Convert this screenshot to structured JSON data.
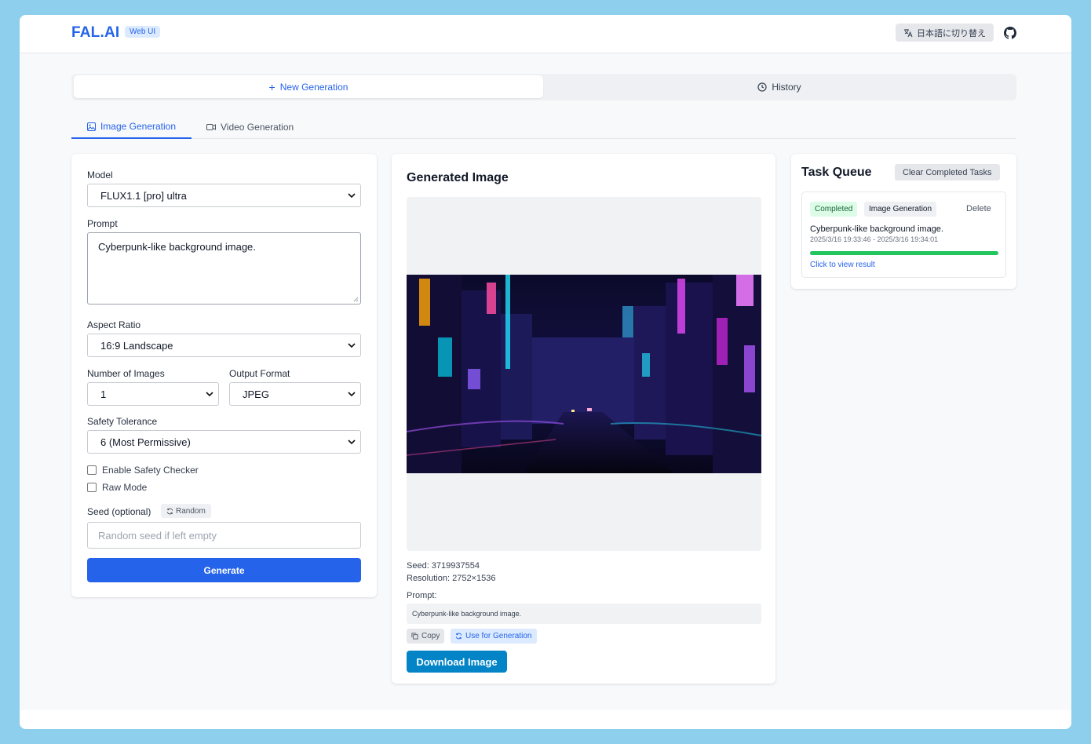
{
  "header": {
    "logo": "FAL.AI",
    "badge": "Web UI",
    "language_button": "日本語に切り替え"
  },
  "main_tabs": [
    {
      "label": "New Generation",
      "icon": "plus-icon",
      "active": true
    },
    {
      "label": "History",
      "icon": "clock-icon",
      "active": false
    }
  ],
  "sub_tabs": [
    {
      "label": "Image Generation",
      "icon": "image-icon",
      "active": true
    },
    {
      "label": "Video Generation",
      "icon": "video-icon",
      "active": false
    }
  ],
  "form": {
    "model_label": "Model",
    "model_value": "FLUX1.1 [pro] ultra",
    "prompt_label": "Prompt",
    "prompt_value": "Cyberpunk-like background image.",
    "aspect_label": "Aspect Ratio",
    "aspect_value": "16:9 Landscape",
    "num_images_label": "Number of Images",
    "num_images_value": "1",
    "format_label": "Output Format",
    "format_value": "JPEG",
    "safety_label": "Safety Tolerance",
    "safety_value": "6 (Most Permissive)",
    "safety_checker_label": "Enable Safety Checker",
    "raw_mode_label": "Raw Mode",
    "seed_label": "Seed (optional)",
    "random_button": "Random",
    "seed_placeholder": "Random seed if left empty",
    "generate_button": "Generate"
  },
  "result": {
    "title": "Generated Image",
    "seed_text": "Seed: 3719937554",
    "resolution_text": "Resolution: 2752×1536",
    "prompt_label": "Prompt:",
    "prompt_value": "Cyberpunk-like background image.",
    "copy_button": "Copy",
    "use_button": "Use for Generation",
    "download_button": "Download Image",
    "image_description": "cyberpunk-city-street-image"
  },
  "queue": {
    "title": "Task Queue",
    "clear_button": "Clear Completed Tasks",
    "tasks": [
      {
        "status": "Completed",
        "type": "Image Generation",
        "delete": "Delete",
        "title": "Cyberpunk-like background image.",
        "time": "2025/3/16 19:33:46 - 2025/3/16 19:34:01",
        "progress": 1.0,
        "link": "Click to view result"
      }
    ]
  },
  "colors": {
    "accent": "#2563eb",
    "download": "#0284c7",
    "success": "#22c55e",
    "background": "#8ecfee"
  }
}
